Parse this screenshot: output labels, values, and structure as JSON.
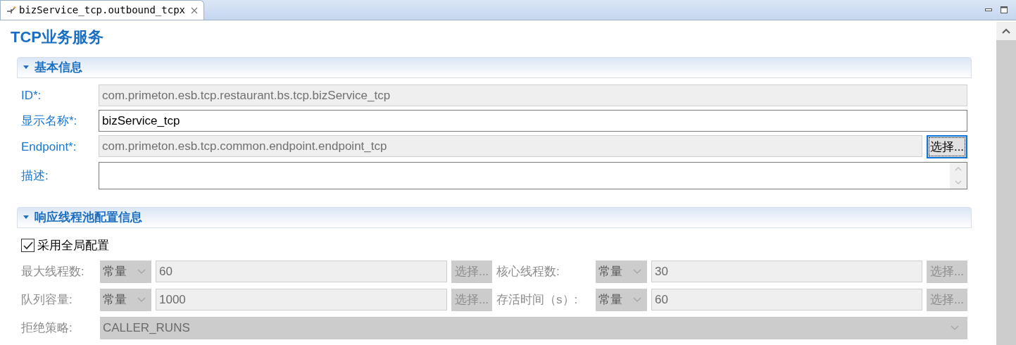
{
  "tab": {
    "label": "bizService_tcp.outbound_tcpx",
    "selected": true
  },
  "title": "TCP业务服务",
  "basic": {
    "title": "基本信息",
    "expanded": true,
    "fields": [
      {
        "kind": "readonly",
        "label": "ID*:",
        "value": "com.primeton.esb.tcp.restaurant.bs.tcp.bizService_tcp"
      },
      {
        "kind": "text",
        "label": "显示名称*:",
        "value": "bizService_tcp"
      },
      {
        "kind": "readonly_button",
        "label": "Endpoint*:",
        "value": "com.primeton.esb.tcp.common.endpoint.endpoint_tcp",
        "button": "选择..."
      },
      {
        "kind": "textarea",
        "label": "描述:"
      }
    ]
  },
  "pool": {
    "title": "响应线程池配置信息",
    "expanded": true,
    "checkbox": {
      "label": "采用全局配置",
      "checked": true
    },
    "disabled": true,
    "rows": [
      [
        {
          "label": "最大线程数:",
          "type": "常量",
          "value": "60",
          "button": "选择..."
        },
        {
          "label": "核心线程数:",
          "type": "常量",
          "value": "30",
          "button": "选择..."
        }
      ],
      [
        {
          "label": "队列容量:",
          "type": "常量",
          "value": "1000",
          "button": "选择..."
        },
        {
          "label": "存活时间（s）:",
          "type": "常量",
          "value": "60",
          "button": "选择..."
        }
      ]
    ],
    "reject": {
      "label": "拒绝策略:",
      "value": "CALLER_RUNS"
    }
  }
}
